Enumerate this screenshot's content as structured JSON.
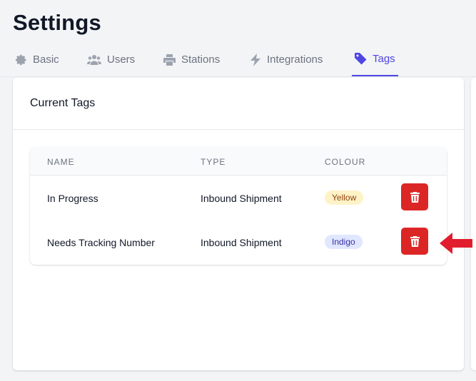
{
  "page": {
    "title": "Settings"
  },
  "tabs": [
    {
      "label": "Basic",
      "icon": "gear-icon"
    },
    {
      "label": "Users",
      "icon": "users-icon"
    },
    {
      "label": "Stations",
      "icon": "printer-icon"
    },
    {
      "label": "Integrations",
      "icon": "bolt-icon"
    },
    {
      "label": "Tags",
      "icon": "tag-icon",
      "active": true
    }
  ],
  "card": {
    "title": "Current Tags"
  },
  "table": {
    "headers": [
      "NAME",
      "TYPE",
      "COLOUR"
    ],
    "rows": [
      {
        "name": "In Progress",
        "type": "Inbound Shipment",
        "colour": "Yellow"
      },
      {
        "name": "Needs Tracking Number",
        "type": "Inbound Shipment",
        "colour": "Indigo"
      }
    ]
  },
  "colors": {
    "accent": "#4f46e5",
    "danger": "#dc2626",
    "annotation_arrow": "#e11d2e"
  }
}
